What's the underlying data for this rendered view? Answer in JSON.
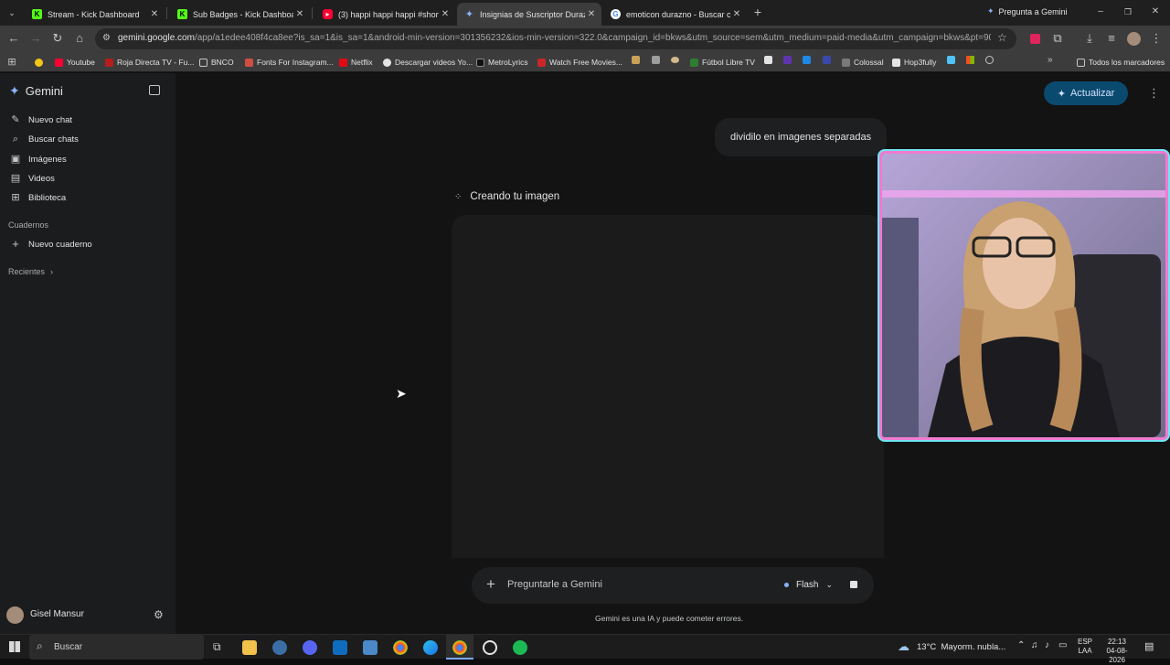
{
  "browser": {
    "tabs": [
      {
        "title": "Stream - Kick Dashboard",
        "favicon": "kick-icon",
        "color": "#53fc18"
      },
      {
        "title": "Sub Badges - Kick Dashboard",
        "favicon": "kick-icon",
        "color": "#53fc18"
      },
      {
        "title": "(3) happi happi happi #shorts #",
        "favicon": "youtube-icon",
        "color": "#ff0033"
      },
      {
        "title": "Insignias de Suscriptor Durazni",
        "favicon": "gemini-icon",
        "color": "#8ab4f8",
        "active": true
      },
      {
        "title": "emoticon durazno - Buscar con",
        "favicon": "google-icon",
        "color": "#ffffff"
      }
    ],
    "ask_gemini": "Pregunta a Gemini",
    "url_host": "gemini.google.com",
    "url_path": "/app/a1edee408f4ca8ee?is_sa=1&is_sa=1&android-min-version=301356232&ios-min-version=322.0&campaign_id=bkws&utm_source=sem&utm_medium=paid-media&utm_campaign=bkws&pt=9008&mt=8...",
    "bookmarks": [
      {
        "label": "",
        "icon": "emoji-icon"
      },
      {
        "label": "Youtube",
        "icon": "youtube-icon"
      },
      {
        "label": "Roja Directa TV - Fu...",
        "icon": "globe-icon"
      },
      {
        "label": "BNCO",
        "icon": "folder-icon"
      },
      {
        "label": "Fonts For Instagram...",
        "icon": "fonts-icon"
      },
      {
        "label": "Netflix",
        "icon": "netflix-icon"
      },
      {
        "label": "Descargar videos Yo...",
        "icon": "download-icon"
      },
      {
        "label": "MetroLyrics",
        "icon": "metrolyrics-icon"
      },
      {
        "label": "Watch Free Movies...",
        "icon": "movies-icon"
      },
      {
        "label": "Fútbol Libre TV",
        "icon": "soccer-icon"
      },
      {
        "label": "Colossal",
        "icon": "colossal-icon"
      },
      {
        "label": "Hop3fully",
        "icon": "hop3fully-icon"
      }
    ],
    "all_bookmarks": "Todos los marcadores"
  },
  "sidebar": {
    "logo": "Gemini",
    "items": [
      {
        "label": "Nuevo chat",
        "icon": "edit-icon"
      },
      {
        "label": "Buscar chats",
        "icon": "search-icon"
      },
      {
        "label": "Imágenes",
        "icon": "image-icon"
      },
      {
        "label": "Videos",
        "icon": "video-icon"
      },
      {
        "label": "Biblioteca",
        "icon": "library-icon"
      }
    ],
    "notebooks_heading": "Cuadernos",
    "new_notebook": "Nuevo cuaderno",
    "recent": "Recientes",
    "user_name": "Gisel Mansur"
  },
  "main": {
    "upgrade_label": "Actualizar",
    "user_message": "dividilo en imagenes separadas",
    "creating_label": "Creando tu imagen",
    "input_placeholder": "Preguntarle a Gemini",
    "model_label": "Flash",
    "disclaimer": "Gemini es una IA y puede cometer errores."
  },
  "taskbar": {
    "search_placeholder": "Buscar",
    "weather": "13°C  Mayorm. nubla...",
    "lang_top": "ESP",
    "lang_bottom": "LAA",
    "time": "22:13",
    "date": "04-08-2026"
  }
}
